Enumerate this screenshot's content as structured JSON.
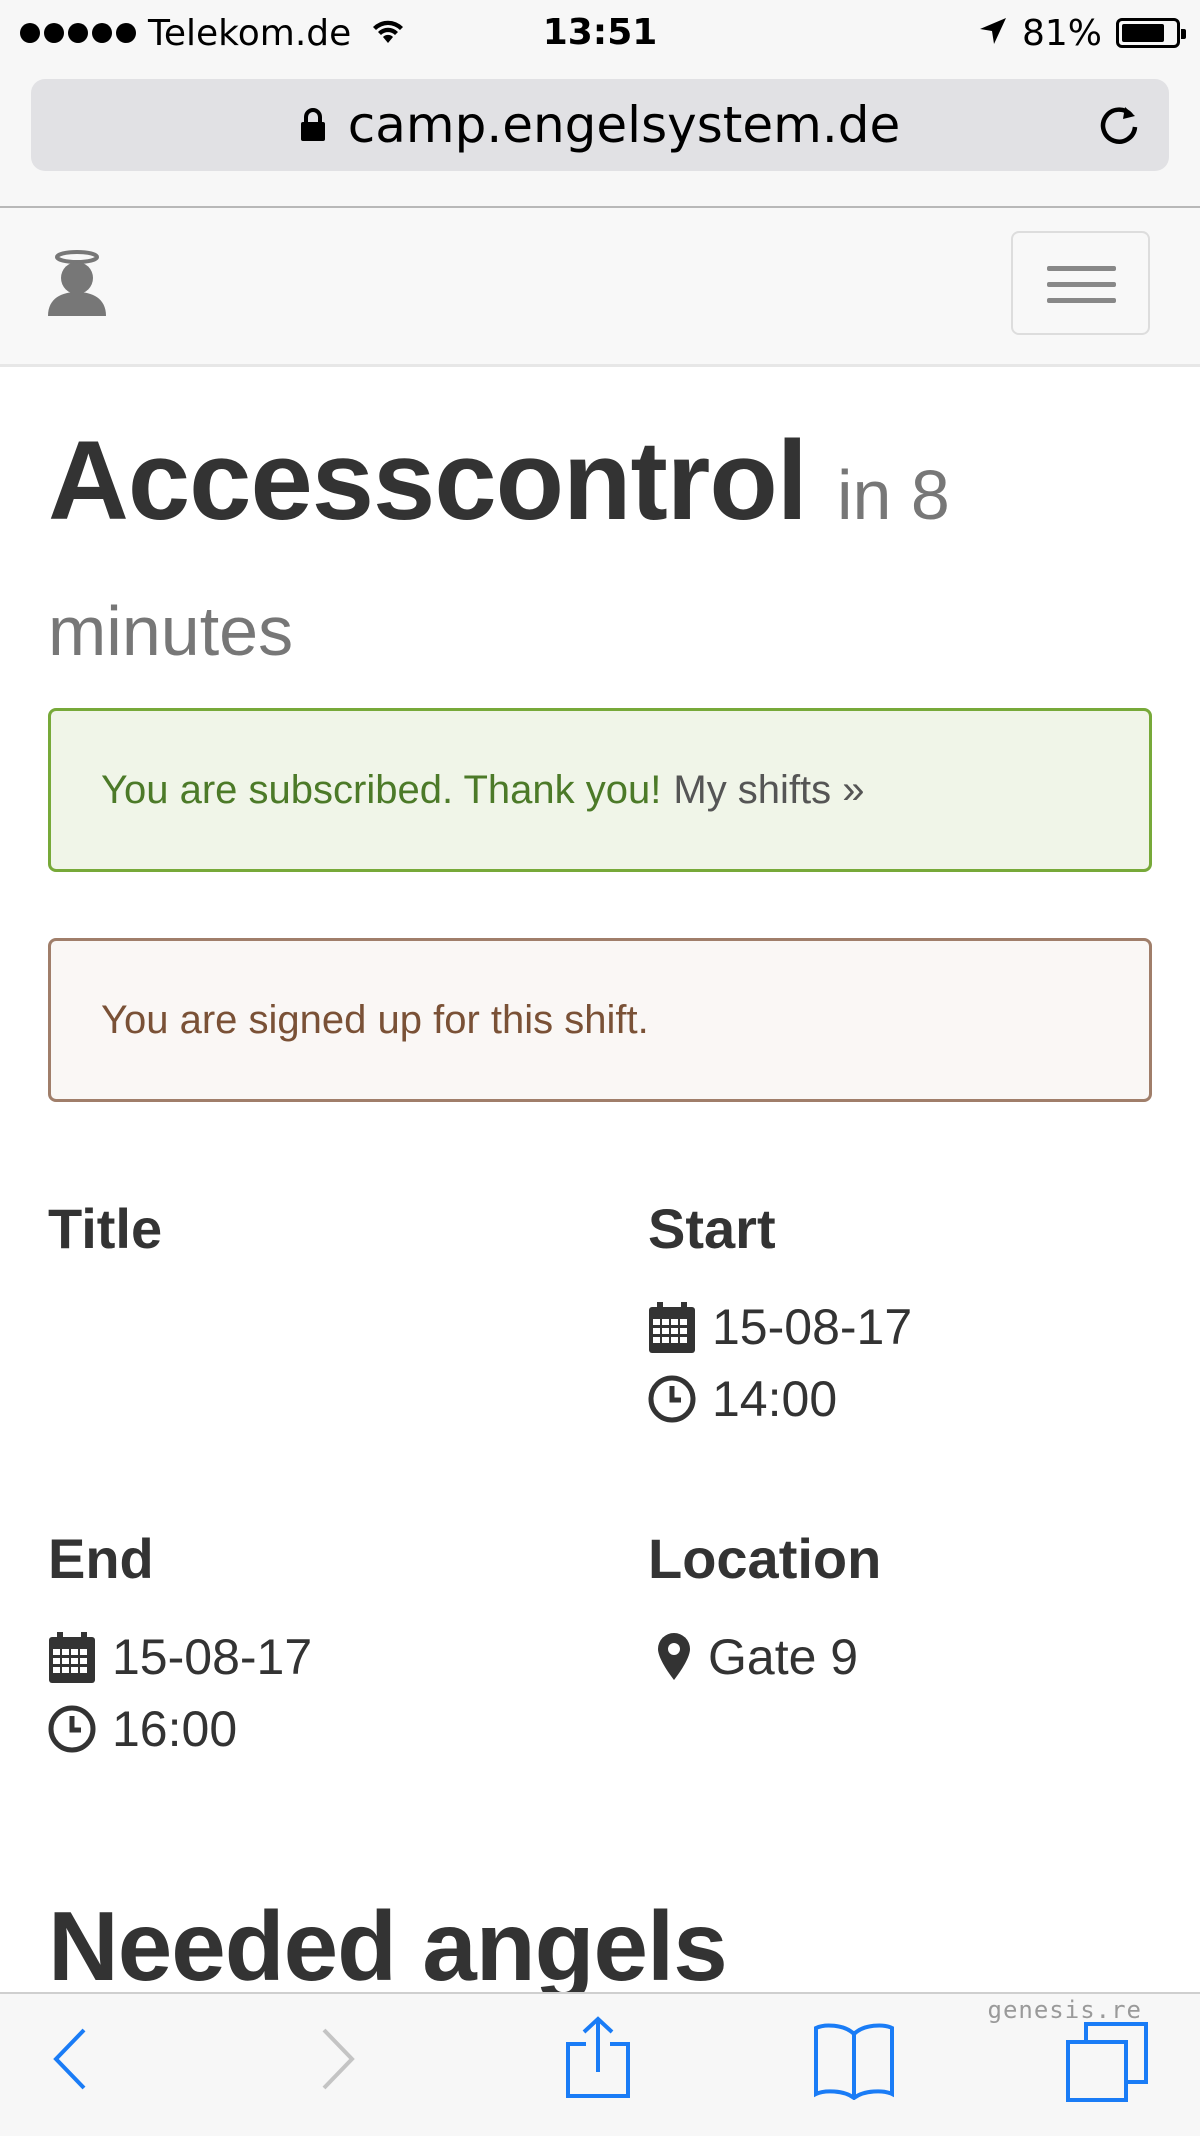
{
  "status_bar": {
    "carrier": "Telekom.de",
    "time": "13:51",
    "battery_percent": "81%",
    "battery_level": 0.81,
    "icons": [
      "signal-dots-icon",
      "wifi-icon",
      "location-arrow-icon",
      "battery-icon"
    ]
  },
  "browser": {
    "url": "camp.engelsystem.de",
    "icons": [
      "lock-icon",
      "reload-icon"
    ]
  },
  "navbar": {
    "icons": [
      "angel-logo-icon",
      "hamburger-menu-icon"
    ]
  },
  "page": {
    "title": "Accesscontrol",
    "title_small": "in 8 minutes",
    "alert_success": {
      "text": "You are subscribed. Thank you!",
      "link": "My shifts »"
    },
    "alert_info": {
      "text": "You are signed up for this shift."
    },
    "details": {
      "title_label": "Title",
      "title_value": "",
      "start_label": "Start",
      "start_date": "15-08-17",
      "start_time": "14:00",
      "end_label": "End",
      "end_date": "15-08-17",
      "end_time": "16:00",
      "location_label": "Location",
      "location_value": "Gate 9"
    },
    "section_heading": "Needed angels"
  },
  "toolbar": {
    "icons": [
      "back-icon",
      "forward-icon",
      "share-icon",
      "bookmarks-icon",
      "tabs-icon"
    ]
  },
  "watermark": "genesis.re",
  "colors": {
    "success_bg": "#f0f5e8",
    "success_border": "#77a939",
    "success_text": "#4c7a28",
    "info_bg": "#faf7f5",
    "info_border": "#a07e6a",
    "info_text": "#7a5136",
    "ios_blue": "#1a7cf6"
  }
}
